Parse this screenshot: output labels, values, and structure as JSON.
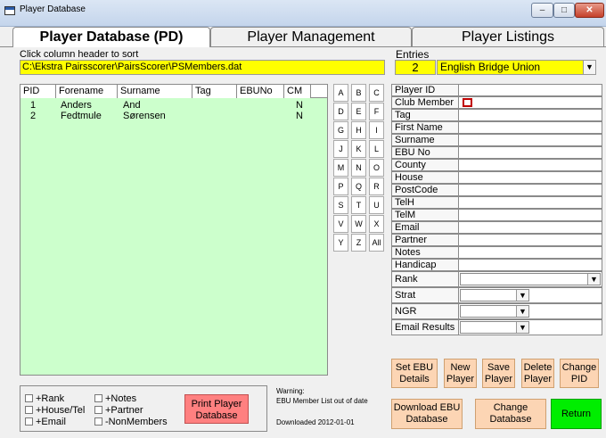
{
  "window": {
    "title": "Player Database",
    "min": "‒",
    "max": "□",
    "close": "✕"
  },
  "tabs": [
    "Player Database (PD)",
    "Player Management",
    "Player Listings"
  ],
  "sort_hint": "Click column header to sort",
  "db_path": "C:\\Ekstra Pairsscorer\\PairsScorer\\PSMembers.dat",
  "entries": {
    "label": "Entries",
    "count": "2",
    "selected": "English Bridge Union"
  },
  "table": {
    "columns": [
      "PID",
      "Forename",
      "Surname",
      "Tag",
      "EBUNo",
      "CM"
    ],
    "rows": [
      [
        "1",
        "Anders",
        "And",
        "",
        "",
        "N"
      ],
      [
        "2",
        "Fedtmule",
        "Sørensen",
        "",
        "",
        "N"
      ]
    ]
  },
  "letters": [
    "A",
    "B",
    "C",
    "D",
    "E",
    "F",
    "G",
    "H",
    "I",
    "J",
    "K",
    "L",
    "M",
    "N",
    "O",
    "P",
    "Q",
    "R",
    "S",
    "T",
    "U",
    "V",
    "W",
    "X",
    "Y",
    "Z",
    "All"
  ],
  "fields": [
    "Player ID",
    "Club Member",
    "Tag",
    "First Name",
    "Surname",
    "EBU No",
    "County",
    "House",
    "PostCode",
    "TelH",
    "TelM",
    "Email",
    "Partner",
    "Notes",
    "Handicap",
    "Rank",
    "Strat",
    "NGR",
    "Email Results"
  ],
  "actions": {
    "set_ebu_1": "Set EBU",
    "set_ebu_2": "Details",
    "new_1": "New",
    "new_2": "Player",
    "save_1": "Save",
    "save_2": "Player",
    "delete_1": "Delete",
    "delete_2": "Player",
    "change_1": "Change",
    "change_2": "PID",
    "download_1": "Download EBU",
    "download_2": "Database",
    "changedb_1": "Change",
    "changedb_2": "Database",
    "return": "Return",
    "print_1": "Print Player",
    "print_2": "Database"
  },
  "options": [
    "+Rank",
    "+Notes",
    "+House/Tel",
    "+Partner",
    "+Email",
    "-NonMembers"
  ],
  "warning": {
    "line1": "Warning:",
    "line2": "EBU Member List out of date",
    "line3": "Downloaded 2012-01-01"
  },
  "colors": {
    "highlight": "#ffff00",
    "grid_bg": "#ccffcc",
    "button": "#fcd5b4",
    "return": "#00ee00",
    "print": "#ff8080"
  }
}
